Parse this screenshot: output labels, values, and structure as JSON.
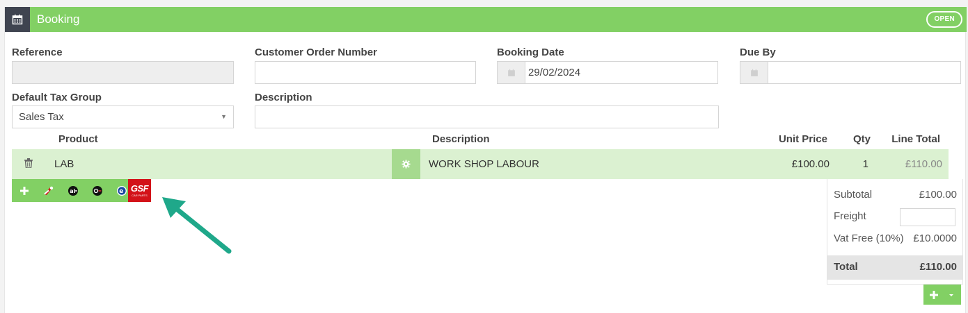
{
  "header": {
    "title": "Booking",
    "status": "OPEN",
    "icon": "calendar-icon"
  },
  "form": {
    "reference": {
      "label": "Reference",
      "value": ""
    },
    "customer_order": {
      "label": "Customer  Order Number",
      "value": ""
    },
    "booking_date": {
      "label": "Booking Date",
      "value": "29/02/2024"
    },
    "due_by": {
      "label": "Due By",
      "value": ""
    },
    "tax_group": {
      "label": "Default Tax Group",
      "value": "Sales Tax"
    },
    "description": {
      "label": "Description",
      "value": ""
    }
  },
  "table": {
    "columns": {
      "product": "Product",
      "description": "Description",
      "unit_price": "Unit Price",
      "qty": "Qty",
      "line_total": "Line Total"
    },
    "rows": [
      {
        "product": "LAB",
        "description": "WORK SHOP LABOUR",
        "unit_price": "£100.00",
        "qty": "1",
        "line_total": "£110.00"
      }
    ]
  },
  "toolbar": {
    "buttons": [
      "add-icon",
      "parts-tool-icon",
      "ai-icon",
      "engine-icon",
      "e-icon"
    ],
    "gsf": {
      "main": "GSF",
      "sub": "CAR PARTS"
    }
  },
  "totals": {
    "subtotal_label": "Subtotal",
    "subtotal": "£100.00",
    "freight_label": "Freight",
    "freight": "",
    "vat_label": "Vat Free (10%)",
    "vat": "£10.0000",
    "total_label": "Total",
    "total": "£110.00"
  },
  "colors": {
    "accent": "#82d064",
    "row": "#dbf1d1",
    "arrow": "#1fa88a",
    "gsf": "#d31219"
  }
}
